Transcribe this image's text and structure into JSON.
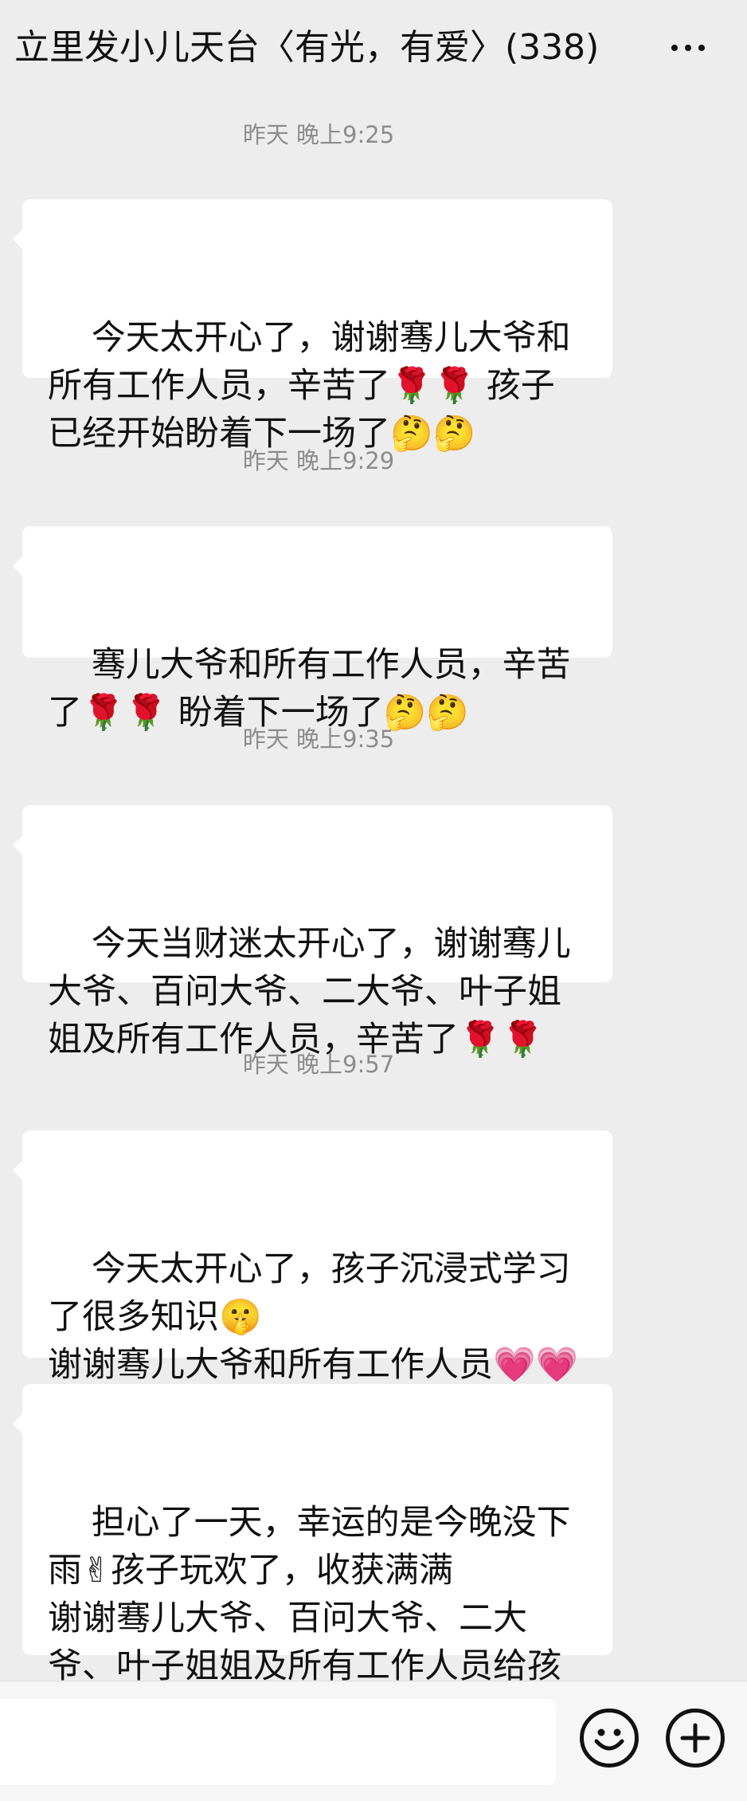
{
  "header": {
    "title": "立里发小儿天台〈有光，有爱〉(338)",
    "more_icon": "more-icon"
  },
  "messages": [
    {
      "timestamp": "昨天 晚上9:25",
      "text": "今天太开心了，谢谢骞儿大爷和所有工作人员，辛苦了🌹🌹 孩子已经开始盼着下一场了🤔🤔"
    },
    {
      "timestamp": "昨天 晚上9:29",
      "text": "骞儿大爷和所有工作人员，辛苦了🌹🌹 盼着下一场了🤔🤔"
    },
    {
      "timestamp": "昨天 晚上9:35",
      "text": "今天当财迷太开心了，谢谢骞儿大爷、百问大爷、二大爷、叶子姐姐及所有工作人员，辛苦了🌹🌹"
    },
    {
      "timestamp": "昨天 晚上9:57",
      "text": "今天太开心了，孩子沉浸式学习了很多知识🤫\n谢谢骞儿大爷和所有工作人员💗💗💗辛苦了。相约下一场🤔"
    },
    {
      "timestamp": "",
      "text": "担心了一天，幸运的是今晚没下雨✌孩子玩欢了，收获满满\n谢谢骞儿大爷、百问大爷、二大爷、叶子姐姐及所有工作人员给孩子带来的欢乐会"
    }
  ],
  "input_bar": {
    "emoji_icon": "emoji-icon",
    "plus_icon": "plus-icon"
  }
}
